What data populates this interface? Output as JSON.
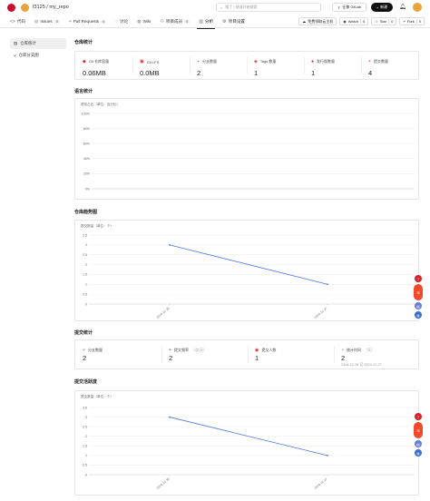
{
  "header": {
    "owner": "f3125",
    "repo": "my_repo",
    "search_placeholder": "搜了 / 快速开始搜索",
    "migrate_label": "迁移 GitLab",
    "new_label": "新建"
  },
  "nav": {
    "tabs": [
      {
        "label": "代码",
        "icon": "code-icon"
      },
      {
        "label": "Issues",
        "count": "0",
        "icon": "issue-icon"
      },
      {
        "label": "Pull Requests",
        "count": "0",
        "icon": "pr-icon"
      },
      {
        "label": "讨论",
        "icon": "discuss-icon"
      },
      {
        "label": "Wiki",
        "icon": "wiki-icon"
      },
      {
        "label": "项目成员",
        "count": "0",
        "icon": "members-icon"
      },
      {
        "label": "分析",
        "icon": "analysis-icon"
      },
      {
        "label": "项目设置",
        "icon": "settings-icon"
      }
    ],
    "actions": {
      "dev": "免费领取云主机",
      "watch": "Watch",
      "watch_count": "0",
      "star": "Star",
      "star_count": "0",
      "fork": "Fork",
      "fork_count": "0"
    }
  },
  "sidebar": {
    "items": [
      {
        "label": "仓库统计"
      },
      {
        "label": "仓库分支图"
      }
    ]
  },
  "repo_stats": {
    "title": "仓库统计",
    "items": [
      {
        "label": "Git 仓库容量",
        "value": "0.06MB"
      },
      {
        "label": "Git LFS",
        "value": "0.0MB"
      },
      {
        "label": "分支数量",
        "value": "2"
      },
      {
        "label": "Tags 数量",
        "value": "1"
      },
      {
        "label": "发行版数量",
        "value": "1"
      },
      {
        "label": "提交数量",
        "value": "4"
      }
    ]
  },
  "language": {
    "title": "语言统计",
    "caption": "语言占比（单位：百分比）"
  },
  "trend": {
    "title": "仓库趋势图",
    "caption": "提交数量（单位：个）"
  },
  "commit_stats": {
    "title": "提交统计",
    "items": [
      {
        "label": "分支数量",
        "value": "2",
        "sub": ""
      },
      {
        "label": "提交频率",
        "value": "2",
        "sub": "（次/天）"
      },
      {
        "label": "提交人数",
        "value": "1",
        "sub": ""
      },
      {
        "label": "统计时间",
        "value": "2",
        "sub": "（天）",
        "range": "2024-12-26 至 2024-12-27"
      }
    ]
  },
  "activity": {
    "title": "提交活跃度",
    "caption": "提交数量（单位：个）"
  },
  "colors": {
    "accent": "#d6242a",
    "line": "#4a78d6"
  },
  "chart_data": [
    {
      "type": "bar",
      "title": "",
      "caption": "语言占比（单位：百分比）",
      "categories": [],
      "values": [],
      "y_ticks": [
        "100%",
        "80%",
        "60%",
        "40%",
        "20%",
        "0%"
      ],
      "ylim": [
        0,
        100
      ]
    },
    {
      "type": "line",
      "caption": "提交数量（单位：个）",
      "x": [
        "2024-12-26",
        "2024-12-27"
      ],
      "values": [
        3,
        1
      ],
      "y_ticks": [
        "3.5",
        "3",
        "2.5",
        "2",
        "1.5",
        "1",
        "0.5",
        "0"
      ],
      "ylim": [
        0,
        3.5
      ]
    },
    {
      "type": "line",
      "caption": "提交数量（单位：个）",
      "x": [
        "2024-12-26",
        "2024-12-27"
      ],
      "values": [
        3,
        1
      ],
      "y_ticks": [
        "3.5",
        "3",
        "2.5",
        "2",
        "1.5",
        "1",
        "0.5",
        "0"
      ],
      "ylim": [
        0,
        3.5
      ]
    }
  ]
}
